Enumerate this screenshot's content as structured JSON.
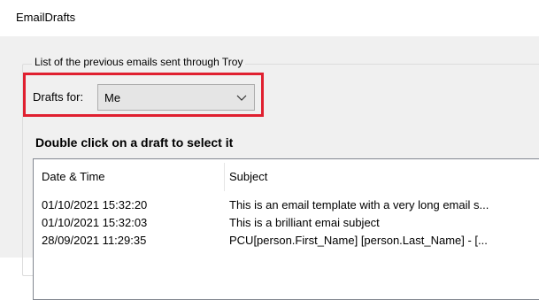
{
  "window": {
    "title": "EmailDrafts"
  },
  "group": {
    "caption": "List of the previous emails sent through Troy"
  },
  "drafts_for": {
    "label": "Drafts for:",
    "selected_value": "Me",
    "icon": "chevron-down-icon"
  },
  "instruction": "Double click on a draft to select it",
  "list": {
    "columns": [
      "Date & Time",
      "Subject"
    ],
    "rows": [
      {
        "date_time": "01/10/2021 15:32:20",
        "subject": "This is an email template with a very long email s..."
      },
      {
        "date_time": "01/10/2021 15:32:03",
        "subject": "This is a brilliant emai subject"
      },
      {
        "date_time": "28/09/2021 11:29:35",
        "subject": "PCU[person.First_Name] [person.Last_Name] - [..."
      }
    ]
  },
  "colors": {
    "highlight": "#e02030",
    "window_background": "#f0f0f0"
  }
}
